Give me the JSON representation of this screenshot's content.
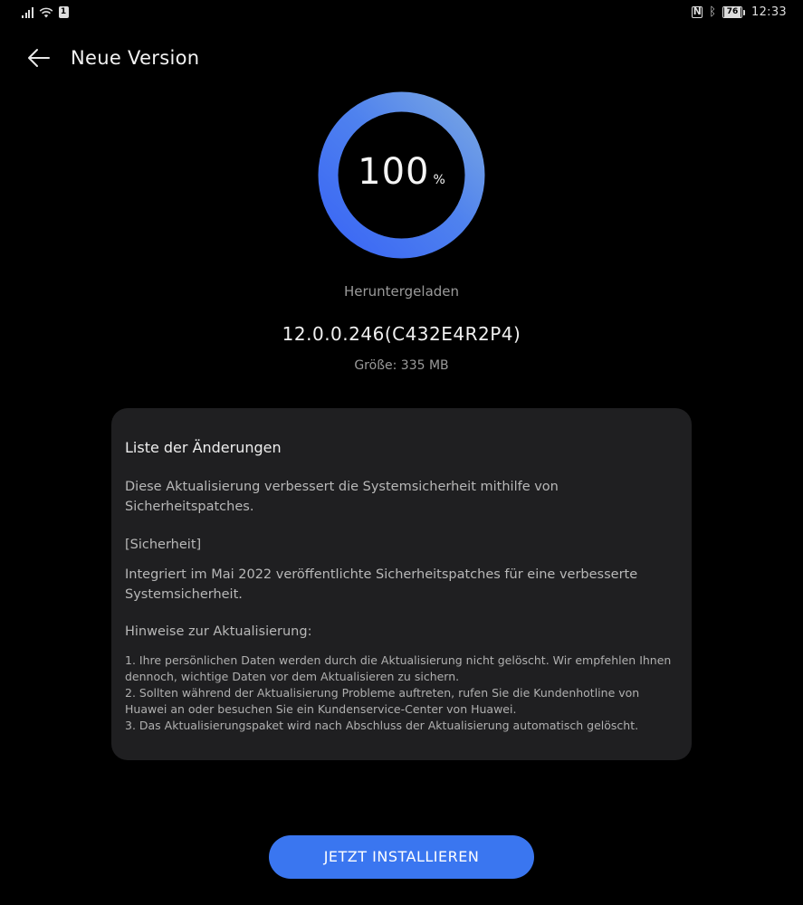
{
  "status_bar": {
    "sim_badge": "1",
    "nfc": "N",
    "bluetooth": "ᛒ",
    "battery_level": "76",
    "time": "12:33",
    "icons": [
      "signal-icon",
      "wifi-icon",
      "sim-icon",
      "nfc-icon",
      "bluetooth-icon",
      "battery-icon"
    ]
  },
  "header": {
    "title": "Neue Version",
    "back_icon": "back-arrow-icon"
  },
  "download": {
    "progress_percent": 100,
    "progress_value": "100",
    "progress_unit": "%",
    "status": "Heruntergeladen",
    "version": "12.0.0.246(C432E4R2P4)",
    "size": "Größe: 335 MB"
  },
  "changelog": {
    "title": "Liste der Änderungen",
    "intro": "Diese Aktualisierung verbessert die Systemsicherheit mithilfe von Sicherheitspatches.",
    "section": "[Sicherheit]",
    "section_text": "Integriert im Mai 2022 veröffentlichte Sicherheitspatches für eine verbesserte Systemsicherheit.",
    "notes_title": "Hinweise zur Aktualisierung:",
    "notes": [
      "1. Ihre persönlichen Daten werden durch die Aktualisierung nicht gelöscht. Wir empfehlen Ihnen dennoch, wichtige Daten vor dem Aktualisieren zu sichern.",
      "2. Sollten während der Aktualisierung Probleme auftreten, rufen Sie die Kundenhotline von Huawei an oder besuchen Sie ein Kundenservice-Center von Huawei.",
      "3. Das Aktualisierungspaket wird nach Abschluss der Aktualisierung automatisch gelöscht."
    ]
  },
  "install_button": {
    "label": "JETZT INSTALLIEREN"
  },
  "colors": {
    "background": "#000000",
    "card": "#1f1f21",
    "accent": "#3a76f0",
    "ring_start": "#3d6ff2",
    "ring_end": "#6f9fe6"
  }
}
